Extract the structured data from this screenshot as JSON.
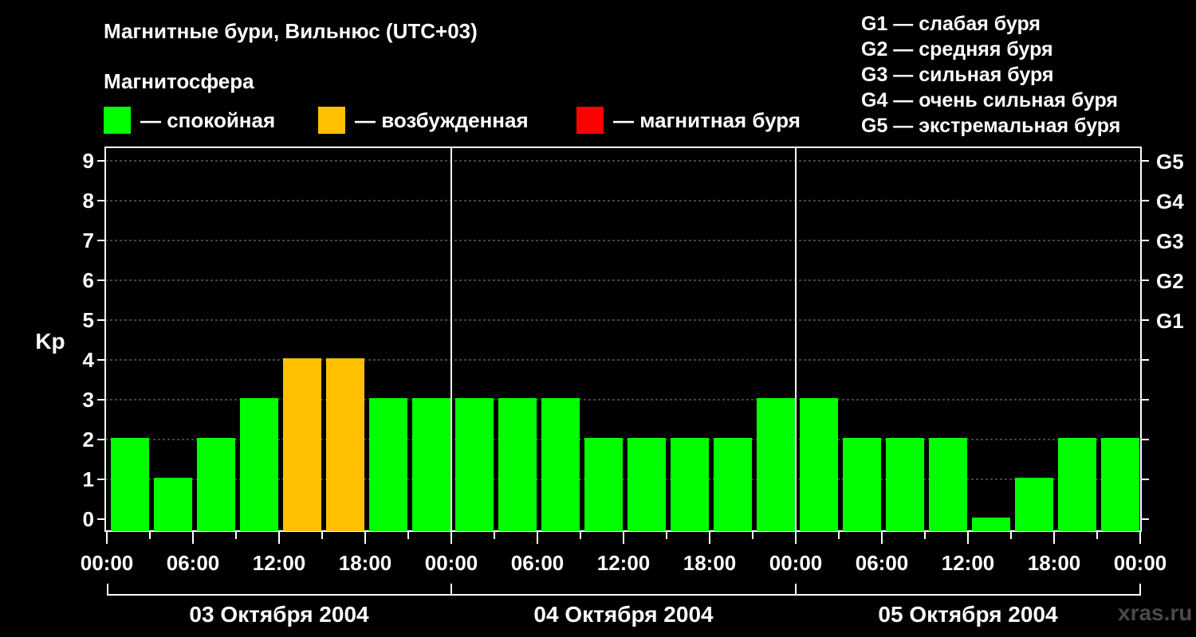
{
  "title": "Магнитные бури, Вильнюс (UTC+03)",
  "subtitle": "Магнитосфера",
  "legend": [
    {
      "label": "— спокойная",
      "color": "#00ff00"
    },
    {
      "label": "— возбужденная",
      "color": "#ffc000"
    },
    {
      "label": "— магнитная буря",
      "color": "#ff0000"
    }
  ],
  "storm_levels": [
    "G1 — слабая буря",
    "G2 — средняя буря",
    "G3 — сильная буря",
    "G4 — очень сильная буря",
    "G5 — экстремальная буря"
  ],
  "watermark": "xras.ru",
  "chart_data": {
    "type": "bar",
    "ylabel": "Kp",
    "ylim": [
      0,
      9
    ],
    "yticks": [
      0,
      1,
      2,
      3,
      4,
      5,
      6,
      7,
      8,
      9
    ],
    "right_axis_labels": [
      {
        "kp": 5,
        "label": "G1"
      },
      {
        "kp": 6,
        "label": "G2"
      },
      {
        "kp": 7,
        "label": "G3"
      },
      {
        "kp": 8,
        "label": "G4"
      },
      {
        "kp": 9,
        "label": "G5"
      }
    ],
    "x_tick_labels": [
      "00:00",
      "06:00",
      "12:00",
      "18:00",
      "00:00",
      "06:00",
      "12:00",
      "18:00",
      "00:00",
      "06:00",
      "12:00",
      "18:00",
      "00:00"
    ],
    "days": [
      "03 Октября 2004",
      "04 Октября 2004",
      "05 Октября 2004"
    ],
    "interval_hours": 3,
    "values": [
      2,
      1,
      2,
      3,
      4,
      4,
      3,
      3,
      3,
      3,
      3,
      2,
      2,
      2,
      2,
      3,
      3,
      2,
      2,
      2,
      0,
      1,
      2,
      2
    ],
    "thresholds": {
      "quiet_max": 3,
      "active_max": 4
    },
    "colors": {
      "quiet": "#00ff00",
      "active": "#ffc000",
      "storm": "#ff0000"
    },
    "grid": true
  }
}
